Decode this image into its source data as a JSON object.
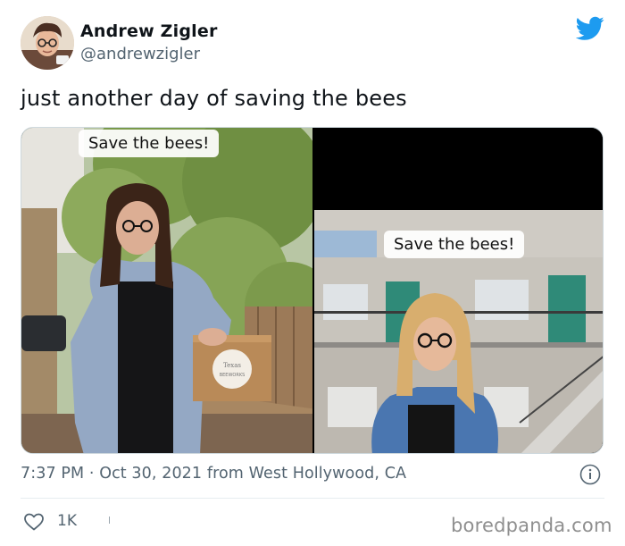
{
  "author": {
    "name": "Andrew Zigler",
    "handle": "@andrewzigler"
  },
  "tweet": {
    "text": "just another day of saving the bees"
  },
  "media": {
    "left_caption": "Save the bees!",
    "right_caption": "Save the bees!",
    "box_brand": "Texas",
    "box_brand_sub": "BEEWORKS"
  },
  "meta": {
    "timestamp": "7:37 PM · Oct 30, 2021 from West Hollywood, CA"
  },
  "actions": {
    "like_count": "1K"
  },
  "watermark": "boredpanda.com",
  "colors": {
    "twitter_blue": "#1d9bf0",
    "muted_text": "#536471"
  },
  "icons": [
    "avatar",
    "twitter-bird-icon",
    "info-icon",
    "heart-icon"
  ]
}
